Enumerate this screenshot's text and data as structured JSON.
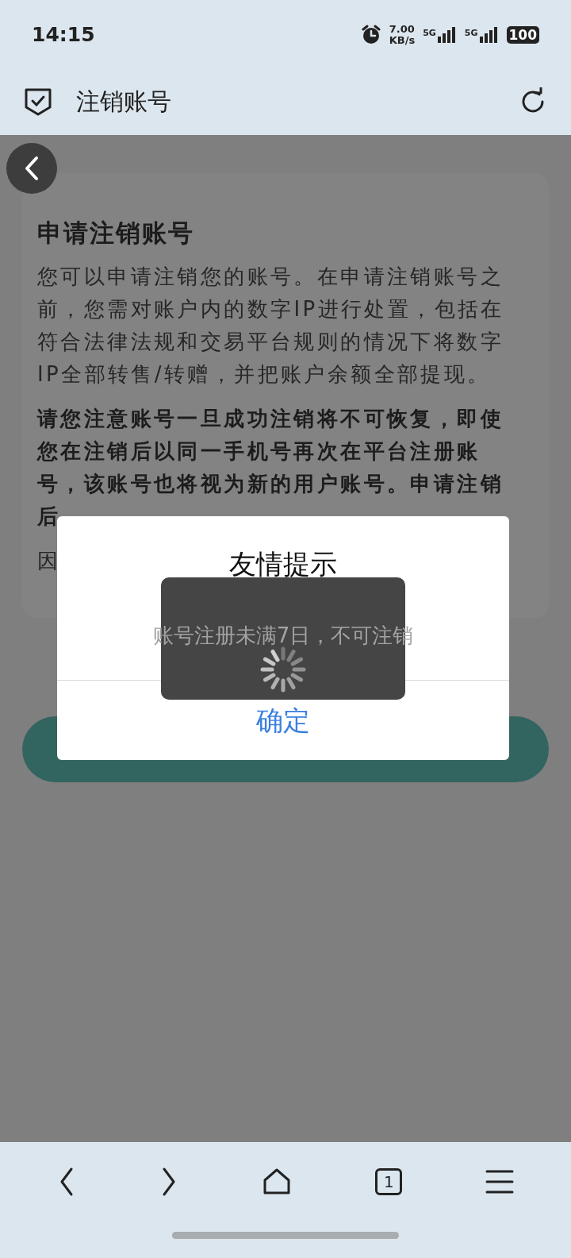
{
  "status_bar": {
    "time": "14:15",
    "speed_value": "7.00",
    "speed_unit": "KB/s",
    "network_1": "5G",
    "network_2": "5G",
    "battery": "100"
  },
  "header": {
    "title": "注销账号"
  },
  "card": {
    "title": "申请注销账号",
    "paragraphs": [
      {
        "kind": "normal",
        "text": "您可以申请注销您的账号。在申请注销账号之前，您需对账户内的数字IP进行处置，包括在符合法律法规和交易平台规则的情况下将数字IP全部转售/转赠，并把账户余额全部提现。"
      },
      {
        "kind": "bold",
        "text": "请您注意账号一旦成功注销将不可恢复，即使您在注销后以同一手机号再次在平台注册账号，该账号也将视为新的用户账号。申请注销后"
      },
      {
        "kind": "normal",
        "text": "因"
      }
    ]
  },
  "dialog": {
    "title": "友情提示",
    "message": "账号注册未满7日，不可注销",
    "button": "确定"
  },
  "loading": {
    "visible": true
  },
  "bottom_nav": {
    "tab_count": "1"
  }
}
